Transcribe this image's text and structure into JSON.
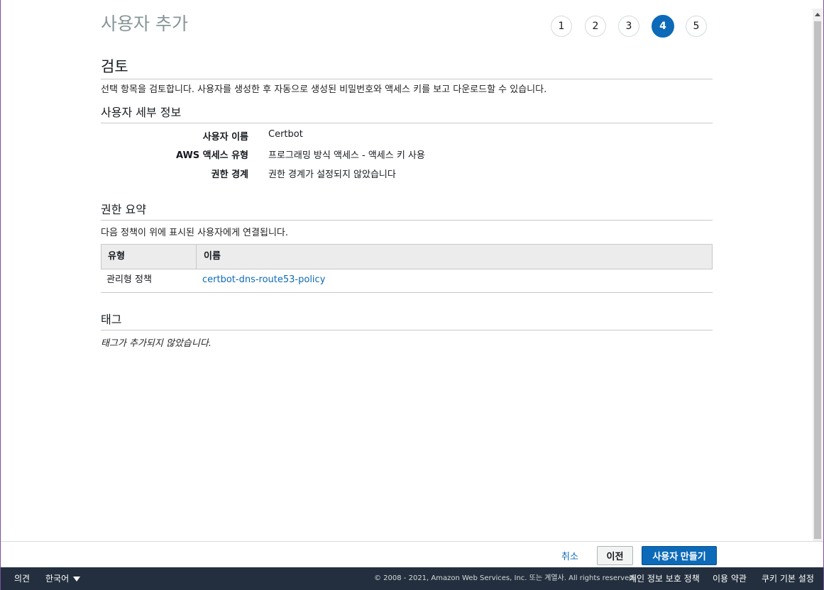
{
  "page": {
    "title": "사용자 추가",
    "steps": [
      "1",
      "2",
      "3",
      "4",
      "5"
    ],
    "active_step": "4"
  },
  "review": {
    "heading": "검토",
    "description": "선택 항목을 검토합니다. 사용자를 생성한 후 자동으로 생성된 비밀번호와 액세스 키를 보고 다운로드할 수 있습니다."
  },
  "details": {
    "heading": "사용자 세부 정보",
    "rows": [
      {
        "key": "사용자 이름",
        "value": "Certbot"
      },
      {
        "key": "AWS 액세스 유형",
        "value": "프로그래밍 방식 액세스 - 액세스 키 사용"
      },
      {
        "key": "권한 경계",
        "value": "권한 경계가 설정되지 않았습니다"
      }
    ]
  },
  "permissions": {
    "heading": "권한 요약",
    "description": "다음 정책이 위에 표시된 사용자에게 연결됩니다.",
    "columns": [
      "유형",
      "이름"
    ],
    "rows": [
      {
        "type": "관리형 정책",
        "name": "certbot-dns-route53-policy"
      }
    ]
  },
  "tags": {
    "heading": "태그",
    "empty": "태그가 추가되지 않았습니다."
  },
  "actions": {
    "cancel": "취소",
    "previous": "이전",
    "create": "사용자 만들기"
  },
  "footer": {
    "feedback": "의견",
    "language": "한국어",
    "copyright": "© 2008 - 2021, Amazon Web Services, Inc. 또는 계열사. All rights reserved.",
    "privacy": "개인 정보 보호 정책",
    "terms": "이용 약관",
    "cookie": "쿠키 기본 설정"
  },
  "colors": {
    "accent": "#0d6ab8",
    "footer_bg": "#232f3e",
    "title_gray": "#879596"
  }
}
